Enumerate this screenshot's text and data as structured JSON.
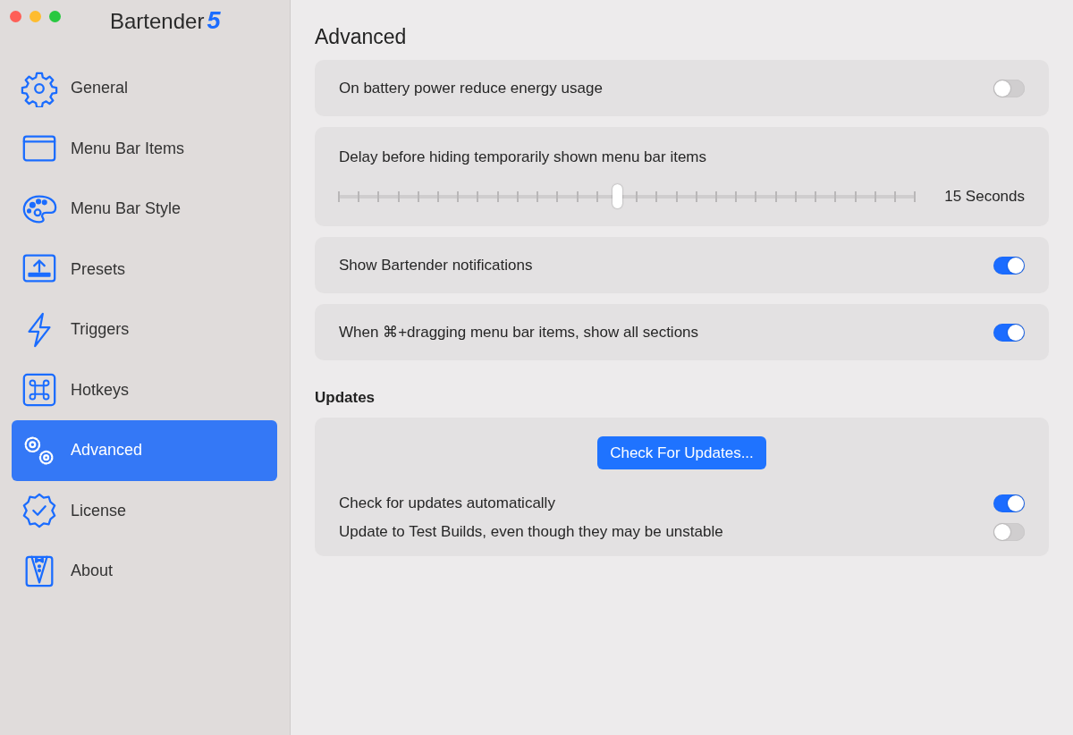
{
  "app_title": {
    "name": "Bartender",
    "version": "5"
  },
  "sidebar": {
    "items": [
      {
        "label": "General",
        "selected": false
      },
      {
        "label": "Menu Bar Items",
        "selected": false
      },
      {
        "label": "Menu Bar Style",
        "selected": false
      },
      {
        "label": "Presets",
        "selected": false
      },
      {
        "label": "Triggers",
        "selected": false
      },
      {
        "label": "Hotkeys",
        "selected": false
      },
      {
        "label": "Advanced",
        "selected": true
      },
      {
        "label": "License",
        "selected": false
      },
      {
        "label": "About",
        "selected": false
      }
    ]
  },
  "page_title": "Advanced",
  "settings": [
    {
      "kind": "toggle",
      "label": "On battery power reduce energy usage",
      "on": false
    },
    {
      "kind": "slider",
      "label": "Delay before hiding temporarily shown menu bar items",
      "level": 0.483,
      "reading": "15 Seconds"
    },
    {
      "kind": "toggle",
      "label": "Show Bartender notifications",
      "on": true
    },
    {
      "kind": "toggle",
      "label": "When ⌘+dragging menu bar items, show all sections",
      "on": true
    }
  ],
  "updates": {
    "heading": "Updates",
    "button": "Check For Updates...",
    "options": [
      {
        "label": "Check for updates automatically",
        "on": true
      },
      {
        "label": "Update to Test Builds, even though they may be unstable",
        "on": false
      }
    ]
  }
}
